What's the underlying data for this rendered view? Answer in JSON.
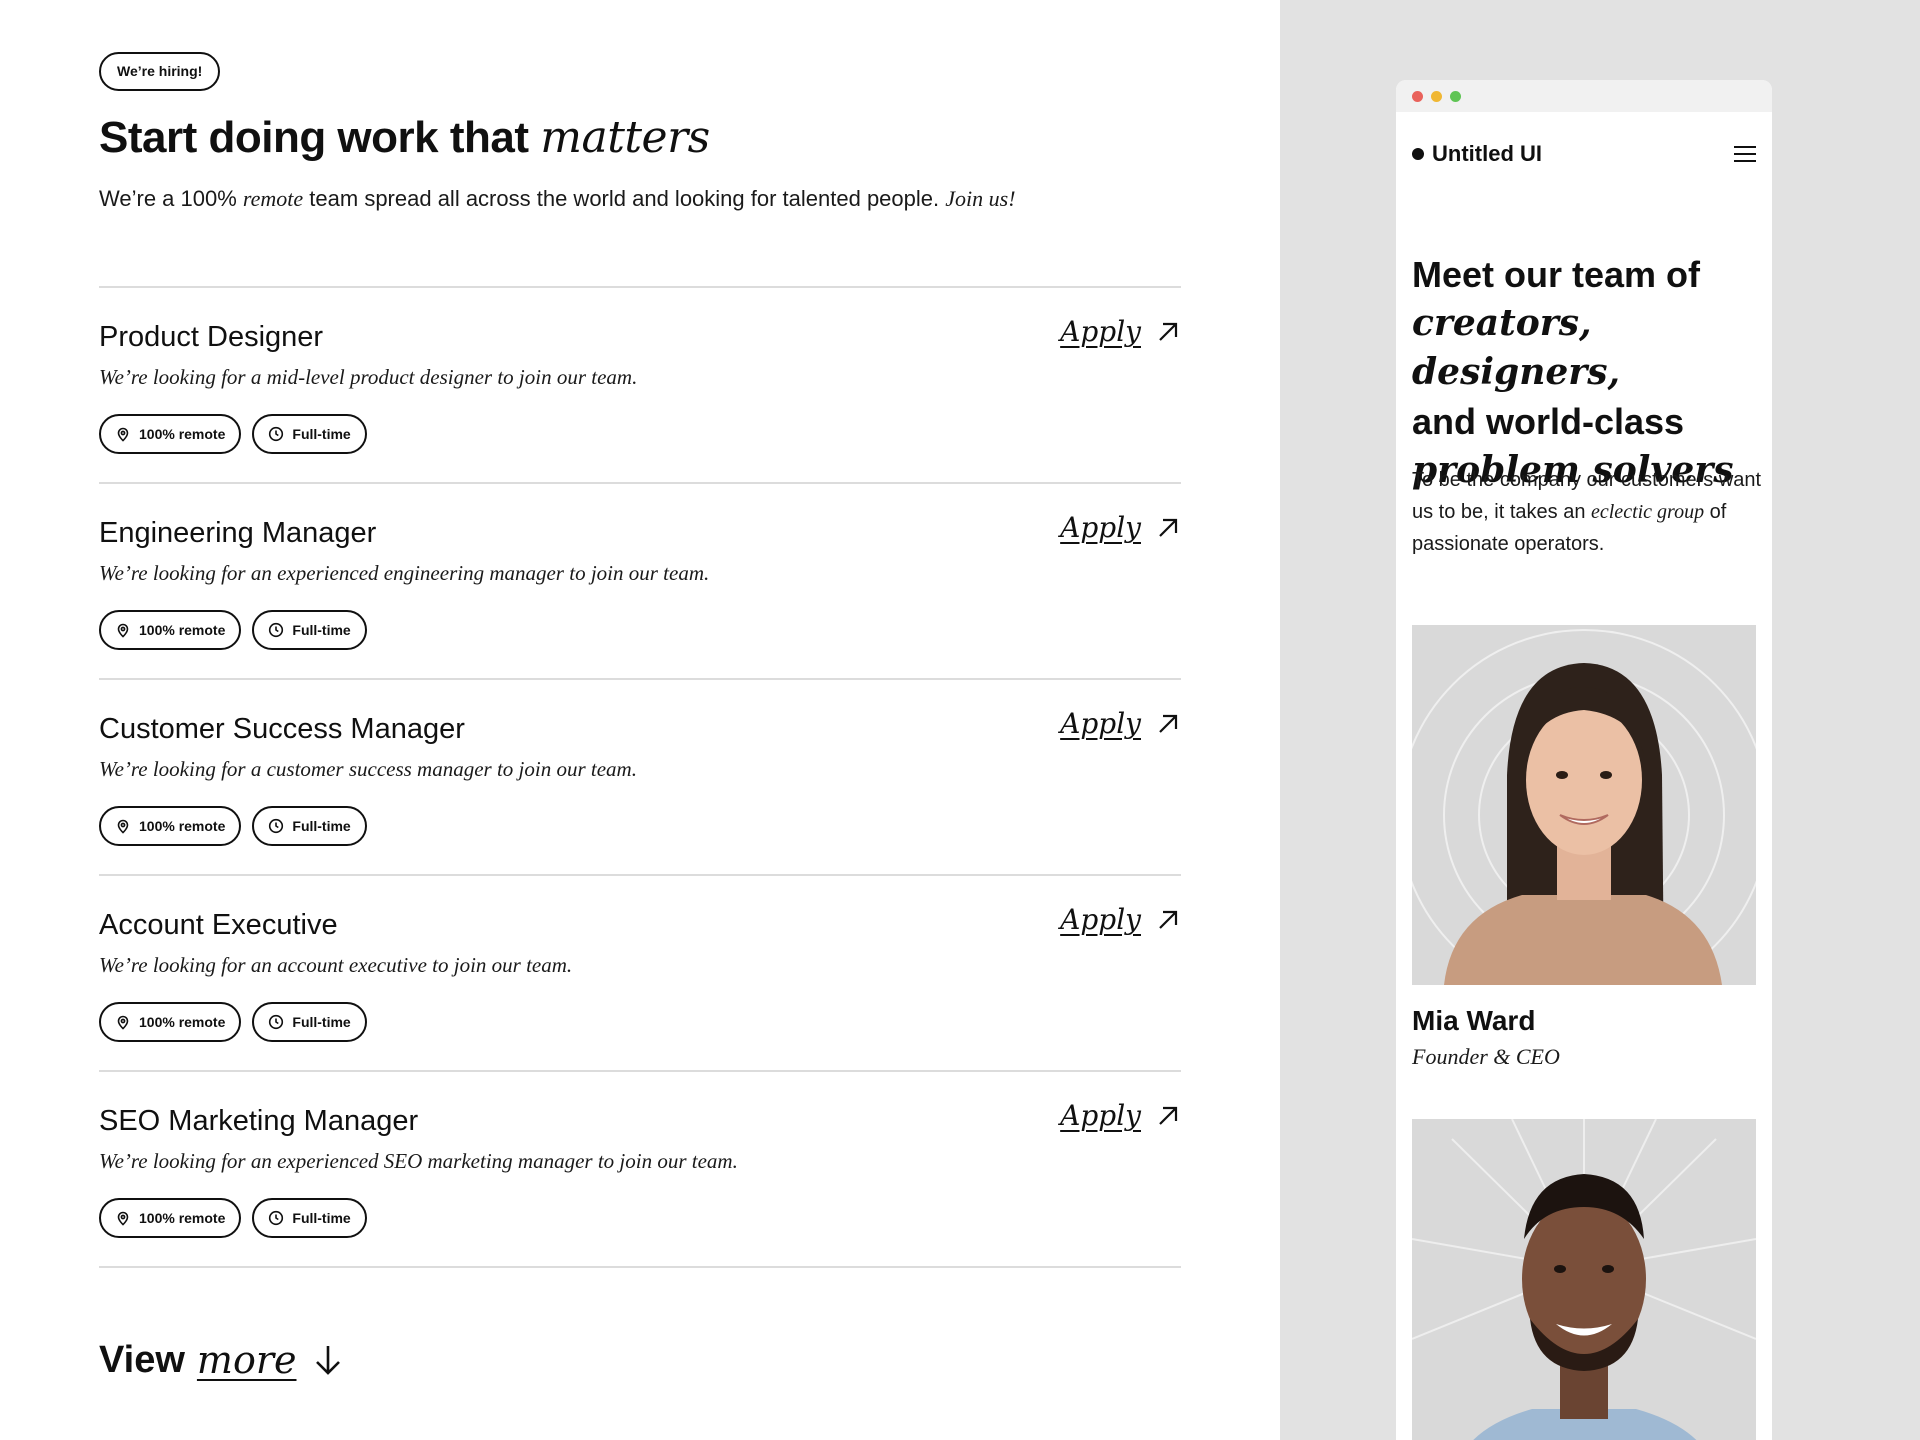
{
  "careers": {
    "badge": "We’re hiring!",
    "headline_plain": "Start doing work that ",
    "headline_emphasis": "matters",
    "subtitle": {
      "part1": "We’re a 100% ",
      "emphasis1": "remote",
      "part2": " team spread all across the world and looking for talented people. ",
      "emphasis2": "Join us!"
    },
    "jobs": [
      {
        "title": "Product Designer",
        "description": "We’re looking for a mid-level product designer to join our team.",
        "location": "100% remote",
        "type": "Full-time",
        "apply_label": "Apply"
      },
      {
        "title": "Engineering Manager",
        "description": "We’re looking for an experienced engineering manager to join our team.",
        "location": "100% remote",
        "type": "Full-time",
        "apply_label": "Apply"
      },
      {
        "title": "Customer Success Manager",
        "description": "We’re looking for a customer success manager to join our team.",
        "location": "100% remote",
        "type": "Full-time",
        "apply_label": "Apply"
      },
      {
        "title": "Account Executive",
        "description": "We’re looking for an account executive to join our team.",
        "location": "100% remote",
        "type": "Full-time",
        "apply_label": "Apply"
      },
      {
        "title": "SEO Marketing Manager",
        "description": "We’re looking for an experienced SEO marketing manager to join our team.",
        "location": "100% remote",
        "type": "Full-time",
        "apply_label": "Apply"
      }
    ],
    "view_more": {
      "plain": "View ",
      "emphasis": "more"
    }
  },
  "mobile": {
    "window_dots": [
      "#e9625b",
      "#f0b733",
      "#5fc454"
    ],
    "logo_text": "Untitled UI",
    "headline": {
      "line1": "Meet our team of",
      "line2": "creators, designers,",
      "line3": "and world-class",
      "line4": "problem solvers"
    },
    "body": {
      "part1": "To be the company our customers want us to be, it takes an ",
      "emphasis": "eclectic group",
      "part2": " of passionate operators."
    },
    "team": [
      {
        "name": "Mia Ward",
        "role": "Founder & CEO"
      },
      {
        "name": "",
        "role": ""
      }
    ]
  },
  "colors": {
    "text": "#101010",
    "divider": "#dcdcdc",
    "panel_bg": "#e2e2e2",
    "photo_bg": "#d9d9d9"
  }
}
